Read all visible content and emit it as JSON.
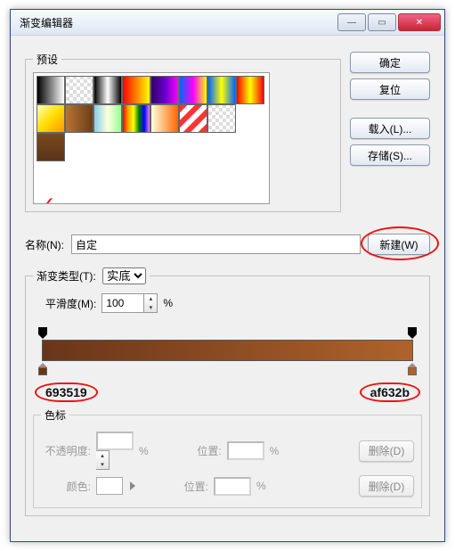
{
  "window": {
    "title": "渐变编辑器"
  },
  "actions": {
    "ok": "确定",
    "reset": "复位",
    "load": "载入(L)...",
    "save": "存储(S)...",
    "new": "新建(W)"
  },
  "presets": {
    "legend": "预设"
  },
  "name": {
    "label": "名称(N):",
    "value": "自定"
  },
  "gtype": {
    "legend_type": "渐变类型(T):",
    "type_value": "实底",
    "smooth_label": "平滑度(M):",
    "smooth_value": "100",
    "pct": "%"
  },
  "annotations": {
    "left_hex": "693519",
    "right_hex": "af632b"
  },
  "stops": {
    "legend": "色标",
    "opacity_label": "不透明度:",
    "pct": "%",
    "position_label": "位置:",
    "delete_label": "删除(D)",
    "color_label": "颜色:"
  },
  "swatches": [
    [
      "linear-gradient(90deg,#000,#fff)",
      "repeating-conic-gradient(#ddd 0 25%,#fff 0 50%) 0/8px 8px",
      "linear-gradient(90deg,#000,#fff,#000)",
      "linear-gradient(90deg,#f00,#ff0)",
      "linear-gradient(90deg,#306,#60c,#f0f)",
      "linear-gradient(90deg,#06f,#f0f,#ff0)",
      "linear-gradient(90deg,#06f,#ff0,#06f)",
      "linear-gradient(90deg,#f00,#ff0,#f00)"
    ],
    [
      "linear-gradient(135deg,#ffb,#fd0,#f90)",
      "linear-gradient(90deg,#b87333,#6b3e1a)",
      "linear-gradient(90deg,#87ceeb,#ffd,#98fb98)",
      "linear-gradient(90deg,red,orange,yellow,green,blue,violet)",
      "linear-gradient(90deg,#ffd,#f60)",
      "repeating-linear-gradient(135deg,#f33 0 6px,#fff 6px 12px)",
      "repeating-conic-gradient(#ddd 0 25%,#fff 0 50%) 0/8px 8px",
      ""
    ],
    [
      "linear-gradient(#7a4a1f,#5a3418)",
      "",
      "",
      "",
      "",
      "",
      "",
      ""
    ]
  ]
}
